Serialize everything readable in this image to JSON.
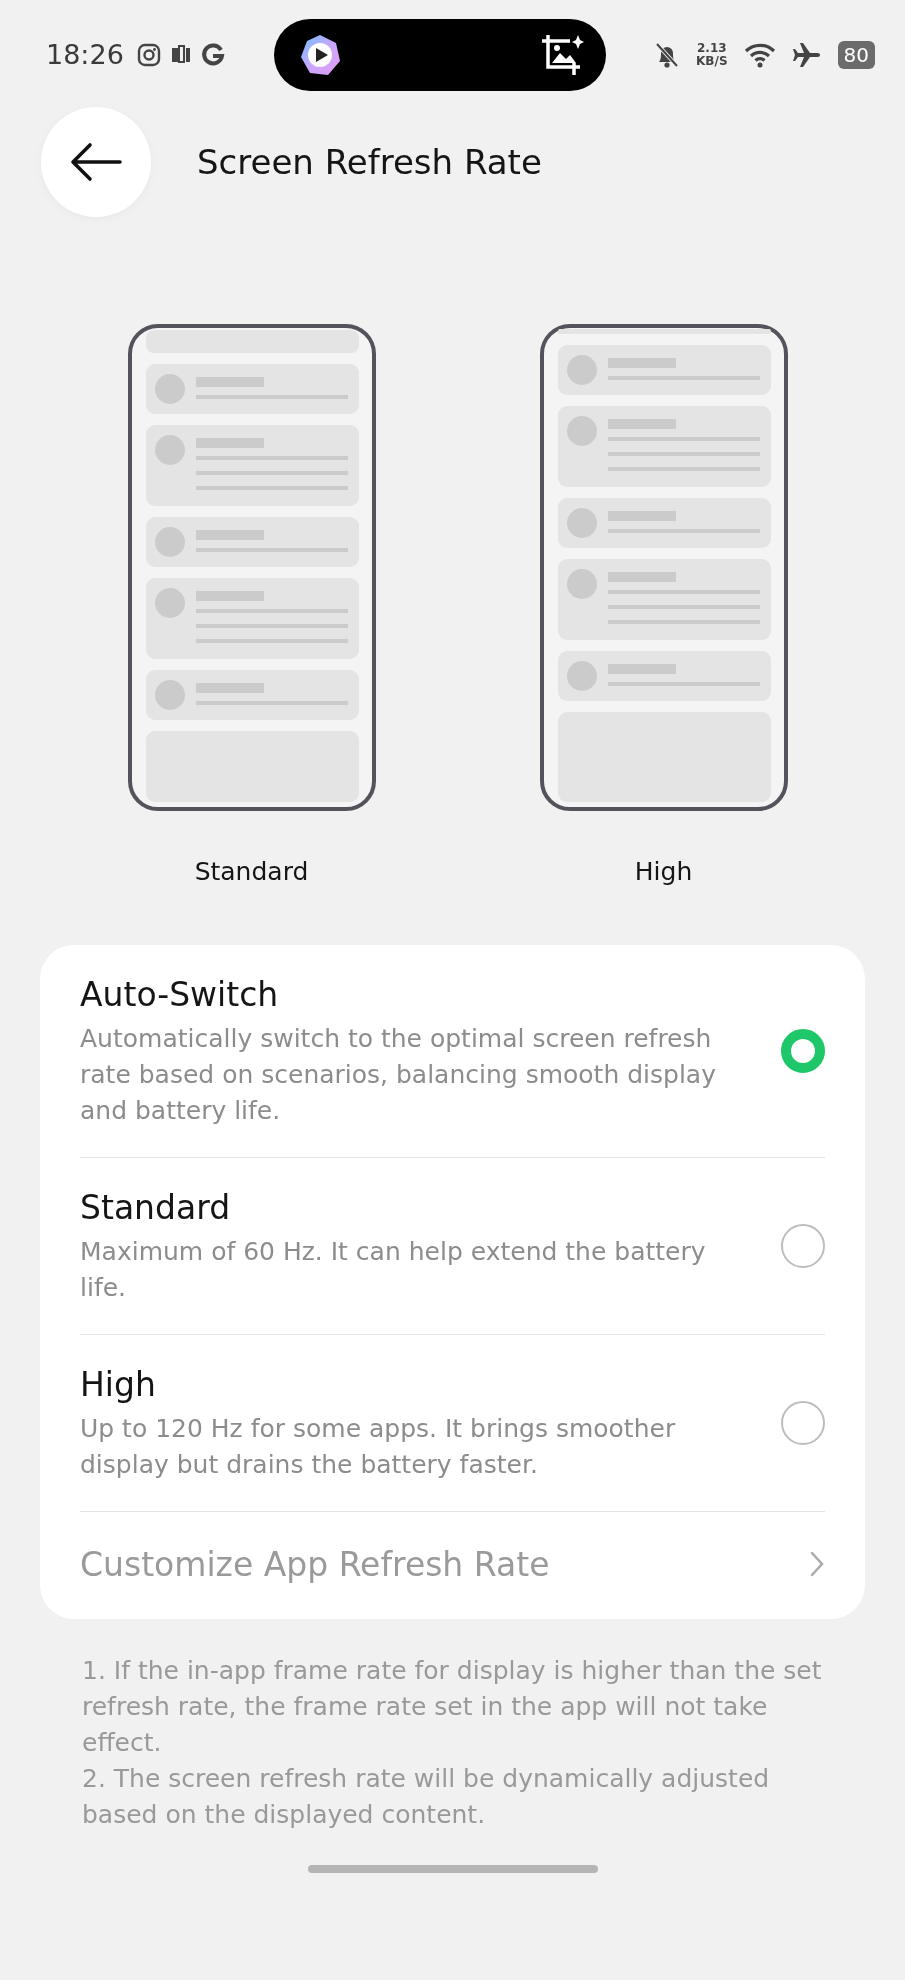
{
  "status_bar": {
    "time": "18:26",
    "network_speed": "2.13",
    "network_unit": "KB/S",
    "battery": "80"
  },
  "header": {
    "title": "Screen Refresh Rate"
  },
  "previews": [
    {
      "label": "Standard",
      "kind": "standard"
    },
    {
      "label": "High",
      "kind": "high"
    }
  ],
  "options": [
    {
      "title": "Auto-Switch",
      "description": "Automatically switch to the optimal screen refresh rate based on scenarios, balancing smooth display and battery life.",
      "selected": true
    },
    {
      "title": "Standard",
      "description": "Maximum of 60 Hz. It can help extend the battery life.",
      "selected": false
    },
    {
      "title": "High",
      "description": "Up to 120 Hz for some apps. It brings smoother display but drains the battery faster.",
      "selected": false
    }
  ],
  "link": {
    "label": "Customize App Refresh Rate"
  },
  "notes": [
    "1. If the in-app frame rate for display is higher than the set refresh rate, the frame rate set in the app will not take effect.",
    "2. The screen refresh rate will be dynamically adjusted based on the displayed content."
  ]
}
